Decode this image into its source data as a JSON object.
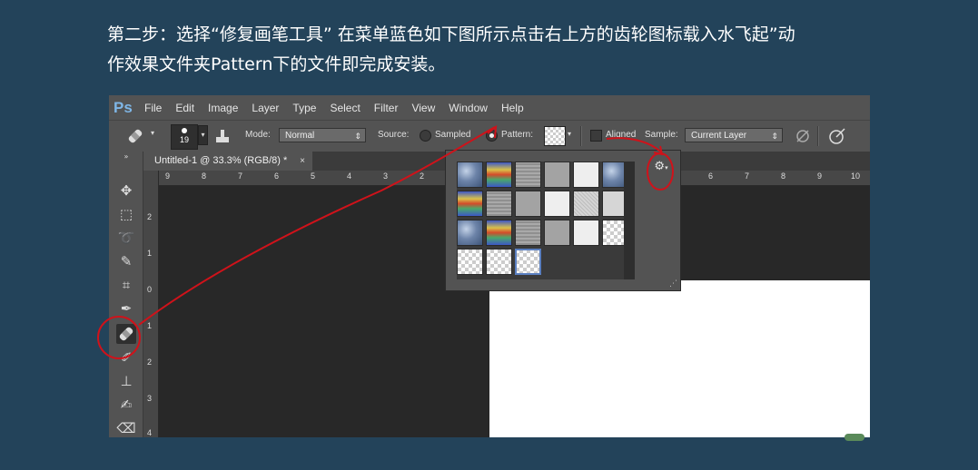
{
  "instructions": {
    "line1": "第二步：选择“修复画笔工具” 在菜单蓝色如下图所示点击右上方的齿轮图标载入水飞起”动",
    "line2": "作效果文件夹Pattern下的文件即完成安装。"
  },
  "app": {
    "logo": "Ps",
    "menu": [
      "File",
      "Edit",
      "Image",
      "Layer",
      "Type",
      "Select",
      "Filter",
      "View",
      "Window",
      "Help"
    ]
  },
  "options": {
    "brush_size": "19",
    "mode_label": "Mode:",
    "mode_value": "Normal",
    "source_label": "Source:",
    "sampled_label": "Sampled",
    "pattern_label": "Pattern:",
    "aligned_label": "Aligned",
    "sample_label": "Sample:",
    "sample_value": "Current Layer",
    "source_selected": "Pattern",
    "aligned_checked": false
  },
  "document": {
    "tab_title": "Untitled-1 @ 33.3% (RGB/8) *",
    "tab_close": "×",
    "ruler_top": [
      "9",
      "8",
      "7",
      "6",
      "5",
      "4",
      "3",
      "2",
      "5",
      "6",
      "7",
      "8",
      "9",
      "10"
    ],
    "ruler_left": [
      "2",
      "1",
      "0",
      "1",
      "2",
      "3",
      "4"
    ]
  },
  "pattern_picker": {
    "gear_icon": "gear-icon",
    "swatches": [
      "bubble",
      "rainbow",
      "gray-lines",
      "gray",
      "white",
      "bubble",
      "rainbow",
      "gray-lines",
      "gray",
      "white",
      "noise",
      "check",
      "bubble",
      "rainbow",
      "gray-lines",
      "gray",
      "white",
      "check",
      "check",
      "check",
      "check-selected"
    ]
  },
  "colors": {
    "page_bg": "#23435a",
    "annotation_red": "#d0121a",
    "ps_panel": "#535353",
    "ps_canvas": "#282828"
  }
}
